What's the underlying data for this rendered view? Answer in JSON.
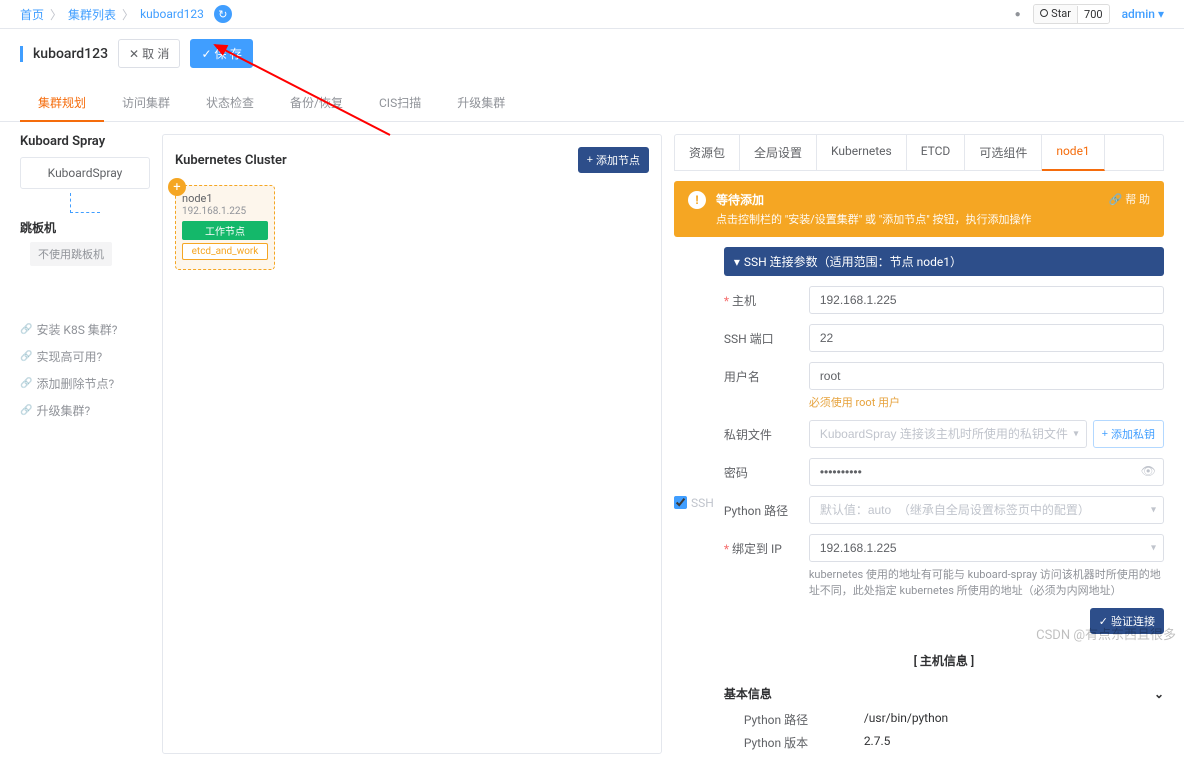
{
  "breadcrumb": {
    "home": "首页",
    "list": "集群列表",
    "current": "kuboard123"
  },
  "github": {
    "star": "Star",
    "count": "700"
  },
  "user": "admin",
  "page_title": "kuboard123",
  "buttons": {
    "cancel": "取 消",
    "save": "保 存",
    "add_node": "添加节点",
    "add_key": "添加私钥",
    "validate": "验证连接"
  },
  "tabs": {
    "plan": "集群规划",
    "access": "访问集群",
    "status": "状态检查",
    "backup": "备份/恢复",
    "cis": "CIS扫描",
    "upgrade": "升级集群"
  },
  "sidebar": {
    "title": "Kuboard Spray",
    "item": "KuboardSpray",
    "jumpbox": "跳板机",
    "jumpbox_btn": "不使用跳板机",
    "help": [
      "安装 K8S 集群?",
      "实现高可用?",
      "添加删除节点?",
      "升级集群?"
    ]
  },
  "cluster": {
    "title": "Kubernetes Cluster",
    "node": {
      "name": "node1",
      "ip": "192.168.1.225",
      "tag_worker": "工作节点",
      "tag_etcd": "etcd_and_work"
    }
  },
  "right_tabs": [
    "资源包",
    "全局设置",
    "Kubernetes",
    "ETCD",
    "可选组件",
    "node1"
  ],
  "alert": {
    "title": "等待添加",
    "desc": "点击控制栏的 \"安装/设置集群\" 或 \"添加节点\" 按钮，执行添加操作",
    "help": "帮 助"
  },
  "ssh_label": "SSH",
  "ssh_header": "SSH 连接参数（适用范围：节点 node1）",
  "form": {
    "host": {
      "label": "主机",
      "value": "192.168.1.225"
    },
    "port": {
      "label": "SSH 端口",
      "value": "22"
    },
    "user": {
      "label": "用户名",
      "value": "root",
      "help": "必须使用 root 用户"
    },
    "keyfile": {
      "label": "私钥文件",
      "placeholder": "KuboardSpray 连接该主机时所使用的私钥文件"
    },
    "password": {
      "label": "密码",
      "value": "••••••••••"
    },
    "python": {
      "label": "Python 路径",
      "placeholder": "默认值：auto  （继承自全局设置标签页中的配置）"
    },
    "bind_ip": {
      "label": "绑定到 IP",
      "value": "192.168.1.225",
      "help": "kubernetes 使用的地址有可能与 kuboard-spray 访问该机器时所使用的地址不同，此处指定 kubernetes 所使用的地址（必须为内网地址）"
    }
  },
  "host_info": "[ 主机信息 ]",
  "basic_info": "基本信息",
  "info": {
    "python_path": {
      "label": "Python 路径",
      "value": "/usr/bin/python"
    },
    "python_ver": {
      "label": "Python 版本",
      "value": "2.7.5"
    }
  }
}
